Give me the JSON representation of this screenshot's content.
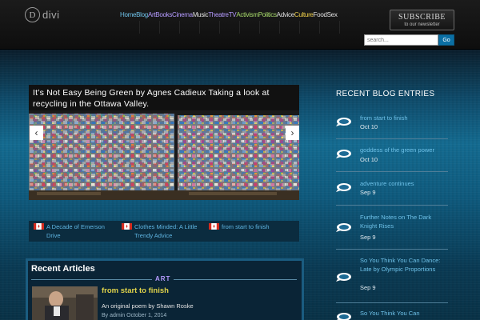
{
  "header": {
    "logo_letter": "D",
    "logo_text": "divi",
    "nav": [
      {
        "label": "Home",
        "color": "blue"
      },
      {
        "label": "Blog",
        "color": "blue"
      },
      {
        "label": "Art",
        "color": "purple"
      },
      {
        "label": "Books",
        "color": "purple"
      },
      {
        "label": "Cinema",
        "color": "purple"
      },
      {
        "label": "Music",
        "color": "white"
      },
      {
        "label": "Theatre",
        "color": "purple"
      },
      {
        "label": "TV",
        "color": "purple"
      },
      {
        "label": "Activism",
        "color": "green"
      },
      {
        "label": "Politics",
        "color": "green"
      },
      {
        "label": "Advice",
        "color": "white"
      },
      {
        "label": "Culture",
        "color": "yellow"
      },
      {
        "label": "Food",
        "color": "white"
      },
      {
        "label": "Sex",
        "color": "white"
      }
    ],
    "subscribe_title": "SUBSCRIBE",
    "subscribe_sub": "to our newsletter",
    "search_placeholder": "search...",
    "search_button": "Go"
  },
  "slider": {
    "caption": "It’s Not Easy Being Green by Agnes Cadieux Taking a look at recycling in the Ottawa Valley.",
    "prev_icon": "chevron-left-icon",
    "next_icon": "chevron-right-icon"
  },
  "thumbs": [
    {
      "title": "A Decade of Emerson Drive"
    },
    {
      "title": "Clothes Minded: A Little Trendy Advice"
    },
    {
      "title": "from start to finish"
    }
  ],
  "articles": {
    "heading": "Recent Articles",
    "category": "ART",
    "items": [
      {
        "title": "from start to finish",
        "excerpt": "An original poem by Shawn Roske",
        "meta": "By admin October 1, 2014"
      }
    ]
  },
  "sidebar": {
    "heading": "RECENT BLOG ENTRIES",
    "entries": [
      {
        "title": "from start to finish",
        "date": "Oct 10"
      },
      {
        "title": "goddess of the green power",
        "date": "Oct 10"
      },
      {
        "title": "adventure continues",
        "date": "Sep 9"
      },
      {
        "title": "Further Notes on The Dark Knight Rises",
        "date": "Sep 9"
      },
      {
        "title": "So You Think You Can Dance: Late by Olympic Proportions",
        "date": "Sep 9"
      },
      {
        "title": "So You Think You Can",
        "date": ""
      }
    ]
  },
  "colors": {
    "nav_blue": "#6ec1e8",
    "nav_purple": "#b59bff",
    "nav_green": "#a6d96a",
    "nav_yellow": "#f0d04a",
    "link_blue": "#5fb5e2",
    "article_title": "#e0d34a"
  }
}
